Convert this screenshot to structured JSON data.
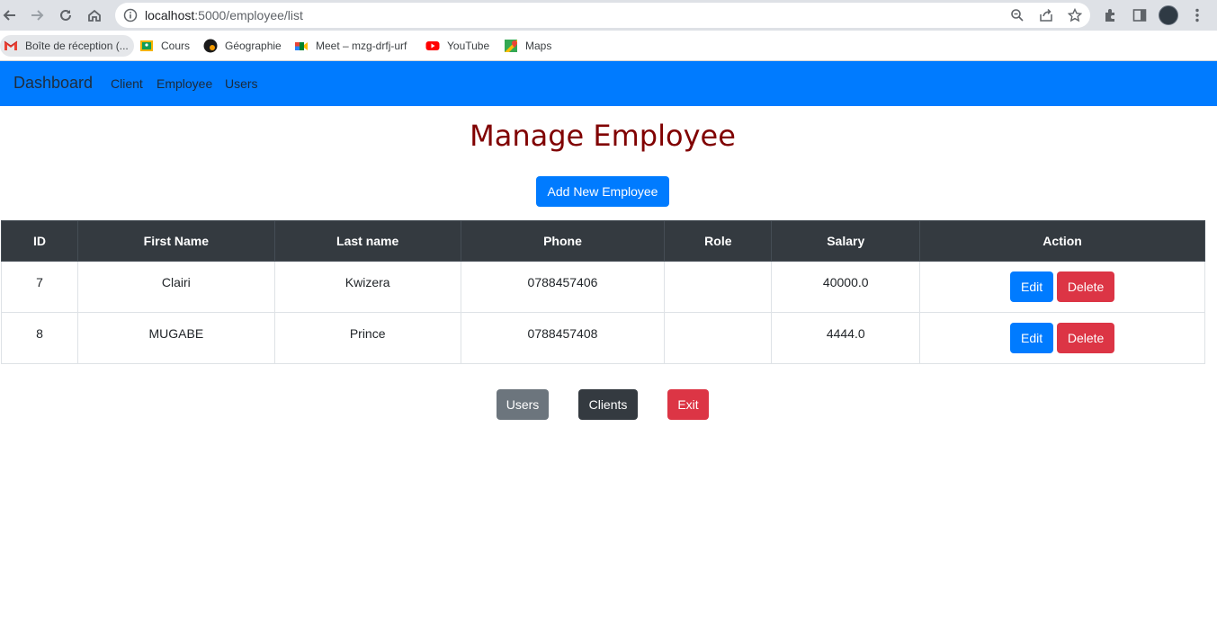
{
  "browser": {
    "url_host": "localhost",
    "url_path": ":5000/employee/list",
    "bookmarks": [
      {
        "label": "Boîte de réception (...",
        "icon": "gmail-icon"
      },
      {
        "label": "Cours",
        "icon": "classroom-icon"
      },
      {
        "label": "Géographie",
        "icon": "avatar-icon"
      },
      {
        "label": "Meet – mzg-drfj-urf",
        "icon": "meet-icon"
      },
      {
        "label": "YouTube",
        "icon": "youtube-icon"
      },
      {
        "label": "Maps",
        "icon": "maps-icon"
      }
    ]
  },
  "navbar": {
    "brand": "Dashboard",
    "links": [
      "Client",
      "Employee",
      "Users"
    ],
    "color": "#007bff"
  },
  "page": {
    "title": "Manage Employee",
    "title_color": "#800000",
    "add_button": "Add New Employee"
  },
  "table": {
    "headers": [
      "ID",
      "First Name",
      "Last name",
      "Phone",
      "Role",
      "Salary",
      "Action"
    ],
    "rows": [
      {
        "id": "7",
        "first_name": "Clairi",
        "last_name": "Kwizera",
        "phone": "0788457406",
        "role": "",
        "salary": "40000.0",
        "edit": "Edit",
        "delete": "Delete"
      },
      {
        "id": "8",
        "first_name": "MUGABE",
        "last_name": "Prince",
        "phone": "0788457408",
        "role": "",
        "salary": "4444.0",
        "edit": "Edit",
        "delete": "Delete"
      }
    ]
  },
  "footer_buttons": {
    "users": "Users",
    "clients": "Clients",
    "exit": "Exit"
  }
}
